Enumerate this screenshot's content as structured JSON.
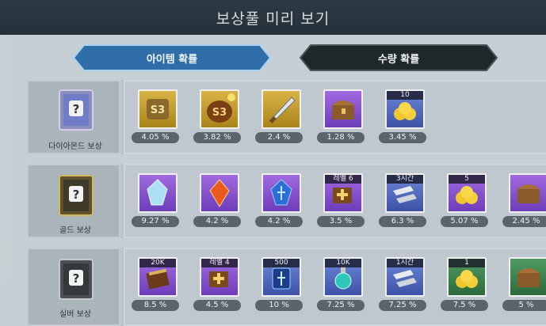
{
  "title": "보상풀 미리 보기",
  "tabs": [
    {
      "label": "아이템 확률",
      "active": true
    },
    {
      "label": "수량 확률",
      "active": false
    }
  ],
  "colors": {
    "tab_active": "#2f6ea8",
    "tab_inactive": "#20272b",
    "rarity_gold": "#c8a232",
    "rarity_purple": "#8a55d0",
    "rarity_blue": "#556ec2",
    "rarity_green": "#3f8450"
  },
  "rows": [
    {
      "label": "다이아몬드 보상",
      "items": [
        {
          "icon": "s3-token-icon",
          "rarity": "gold",
          "badge": "",
          "percent": "4.05 %"
        },
        {
          "icon": "s3-pouch-icon",
          "rarity": "gold",
          "badge": "",
          "percent": "3.82 %"
        },
        {
          "icon": "dagger-icon",
          "rarity": "gold",
          "badge": "",
          "percent": "2.4 %"
        },
        {
          "icon": "treasure-chest-icon",
          "rarity": "purple",
          "badge": "",
          "percent": "1.28 %"
        },
        {
          "icon": "gold-coins-icon",
          "rarity": "blue",
          "badge": "10",
          "percent": "3.45 %"
        }
      ]
    },
    {
      "label": "골드 보상",
      "items": [
        {
          "icon": "crystal-icon",
          "rarity": "purple",
          "badge": "",
          "percent": "9.27 %"
        },
        {
          "icon": "fire-gem-icon",
          "rarity": "purple",
          "badge": "",
          "percent": "4.2 %"
        },
        {
          "icon": "rune-gem-icon",
          "rarity": "purple",
          "badge": "",
          "percent": "4.2 %"
        },
        {
          "icon": "level-chest-icon",
          "rarity": "purple",
          "badge": "레벨 6",
          "percent": "3.5 %"
        },
        {
          "icon": "speedup-icon",
          "rarity": "blue",
          "badge": "3시간",
          "percent": "6.3 %"
        },
        {
          "icon": "gold-coins-icon",
          "rarity": "purple",
          "badge": "5",
          "percent": "5.07 %"
        },
        {
          "icon": "treasure-chest-icon",
          "rarity": "purple",
          "badge": "",
          "percent": "2.45 %"
        }
      ]
    },
    {
      "label": "실버 보상",
      "items": [
        {
          "icon": "book-icon",
          "rarity": "purple",
          "badge": "20K",
          "percent": "8.5 %"
        },
        {
          "icon": "level-chest-icon",
          "rarity": "purple",
          "badge": "레벨 4",
          "percent": "4.5 %"
        },
        {
          "icon": "rune-scroll-icon",
          "rarity": "blue",
          "badge": "500",
          "percent": "10 %"
        },
        {
          "icon": "potion-icon",
          "rarity": "blue",
          "badge": "10K",
          "percent": "7.25 %"
        },
        {
          "icon": "speedup-icon",
          "rarity": "blue",
          "badge": "1시간",
          "percent": "7.25 %"
        },
        {
          "icon": "gold-coins-icon",
          "rarity": "green",
          "badge": "1",
          "percent": "7.5 %"
        },
        {
          "icon": "treasure-chest-icon",
          "rarity": "green",
          "badge": "",
          "percent": "5 %"
        }
      ]
    }
  ]
}
